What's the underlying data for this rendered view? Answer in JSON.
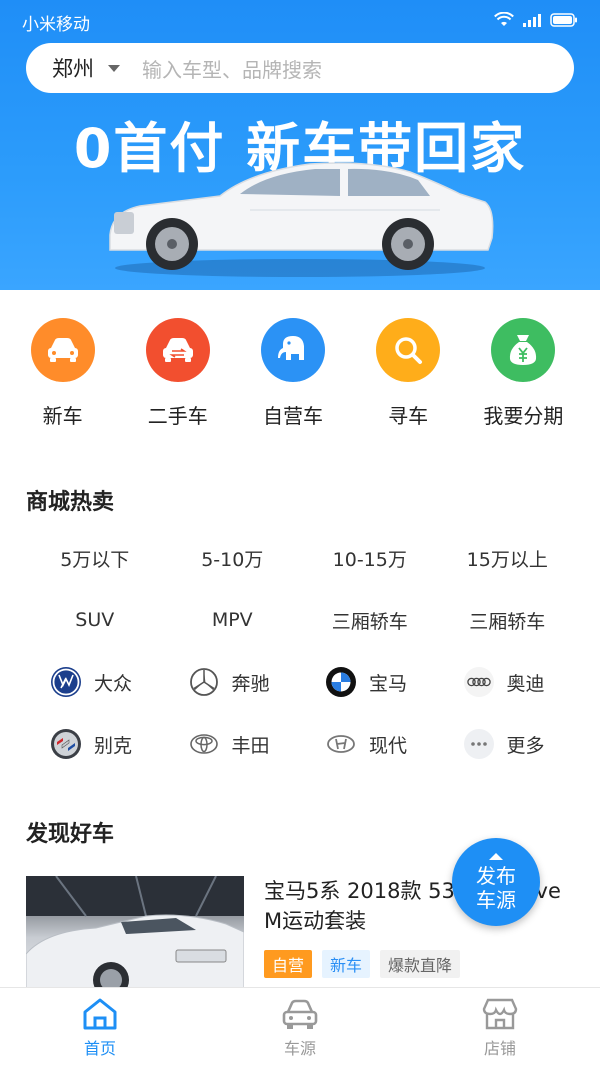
{
  "status_bar": {
    "carrier": "小米移动"
  },
  "search": {
    "city": "郑州",
    "placeholder": "输入车型、品牌搜索"
  },
  "banner": {
    "title": "0首付 新车带回家"
  },
  "categories": [
    {
      "label": "新车",
      "icon": "car-icon",
      "color": "#ff8c2a"
    },
    {
      "label": "二手车",
      "icon": "swap-car-icon",
      "color": "#f24f2f"
    },
    {
      "label": "自营车",
      "icon": "elephant-icon",
      "color": "#2b92f5"
    },
    {
      "label": "寻车",
      "icon": "search-icon",
      "color": "#ffad1a"
    },
    {
      "label": "我要分期",
      "icon": "money-bag-icon",
      "color": "#3ebd61"
    }
  ],
  "hot_section": {
    "title": "商城热卖",
    "price_ranges": [
      "5万以下",
      "5-10万",
      "10-15万",
      "15万以上"
    ],
    "body_types": [
      "SUV",
      "MPV",
      "三厢轿车",
      "三厢轿车"
    ],
    "brands": [
      {
        "name": "大众",
        "icon": "volkswagen-logo-icon"
      },
      {
        "name": "奔驰",
        "icon": "mercedes-logo-icon"
      },
      {
        "name": "宝马",
        "icon": "bmw-logo-icon"
      },
      {
        "name": "奥迪",
        "icon": "audi-logo-icon"
      },
      {
        "name": "别克",
        "icon": "buick-logo-icon"
      },
      {
        "name": "丰田",
        "icon": "toyota-logo-icon"
      },
      {
        "name": "现代",
        "icon": "hyundai-logo-icon"
      },
      {
        "name": "更多",
        "icon": "more-icon"
      }
    ]
  },
  "discover": {
    "title": "发现好车",
    "product": {
      "title": "宝马5系 2018款 530Li xDrive M运动套装",
      "tags": [
        "自营",
        "新车",
        "爆款直降"
      ]
    }
  },
  "fab": {
    "line1": "发布",
    "line2": "车源"
  },
  "bottom_nav": [
    {
      "label": "首页",
      "icon": "home-icon",
      "active": true
    },
    {
      "label": "车源",
      "icon": "car-outline-icon",
      "active": false
    },
    {
      "label": "店铺",
      "icon": "store-icon",
      "active": false
    }
  ],
  "colors": {
    "primary": "#1e8ff5",
    "tag_orange": "#ff9a1f"
  }
}
